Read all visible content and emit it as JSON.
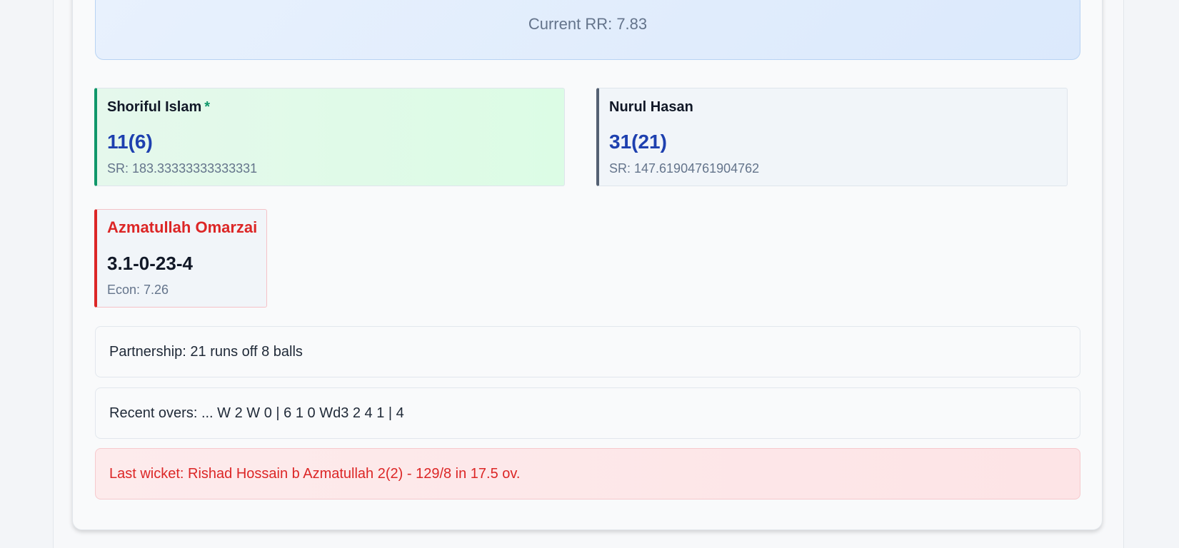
{
  "run_rate": {
    "label": "Current RR: 7.83"
  },
  "batters": [
    {
      "name": "Shoriful Islam",
      "on_strike_marker": "*",
      "score": "11(6)",
      "strike_rate": "SR: 183.33333333333331",
      "accent": "#10976a"
    },
    {
      "name": "Nurul Hasan",
      "score": "31(21)",
      "strike_rate": "SR: 147.61904761904762",
      "accent": "#556173"
    }
  ],
  "bowler": {
    "name": "Azmatullah Omarzai",
    "figures": "3.1-0-23-4",
    "economy": "Econ: 7.26",
    "accent": "#dc2626"
  },
  "partnership": "Partnership: 21 runs off 8 balls",
  "recent_overs": "Recent overs: ... W 2 W 0 | 6 1 0 Wd3 2 4 1 | 4",
  "last_wicket": "Last wicket: Rishad Hossain b Azmatullah 2(2) - 129/8 in 17.5 ov.",
  "colors": {
    "score_blue": "#1e40af",
    "wicket_red": "#dc2626",
    "strike_green": "#10976a"
  }
}
